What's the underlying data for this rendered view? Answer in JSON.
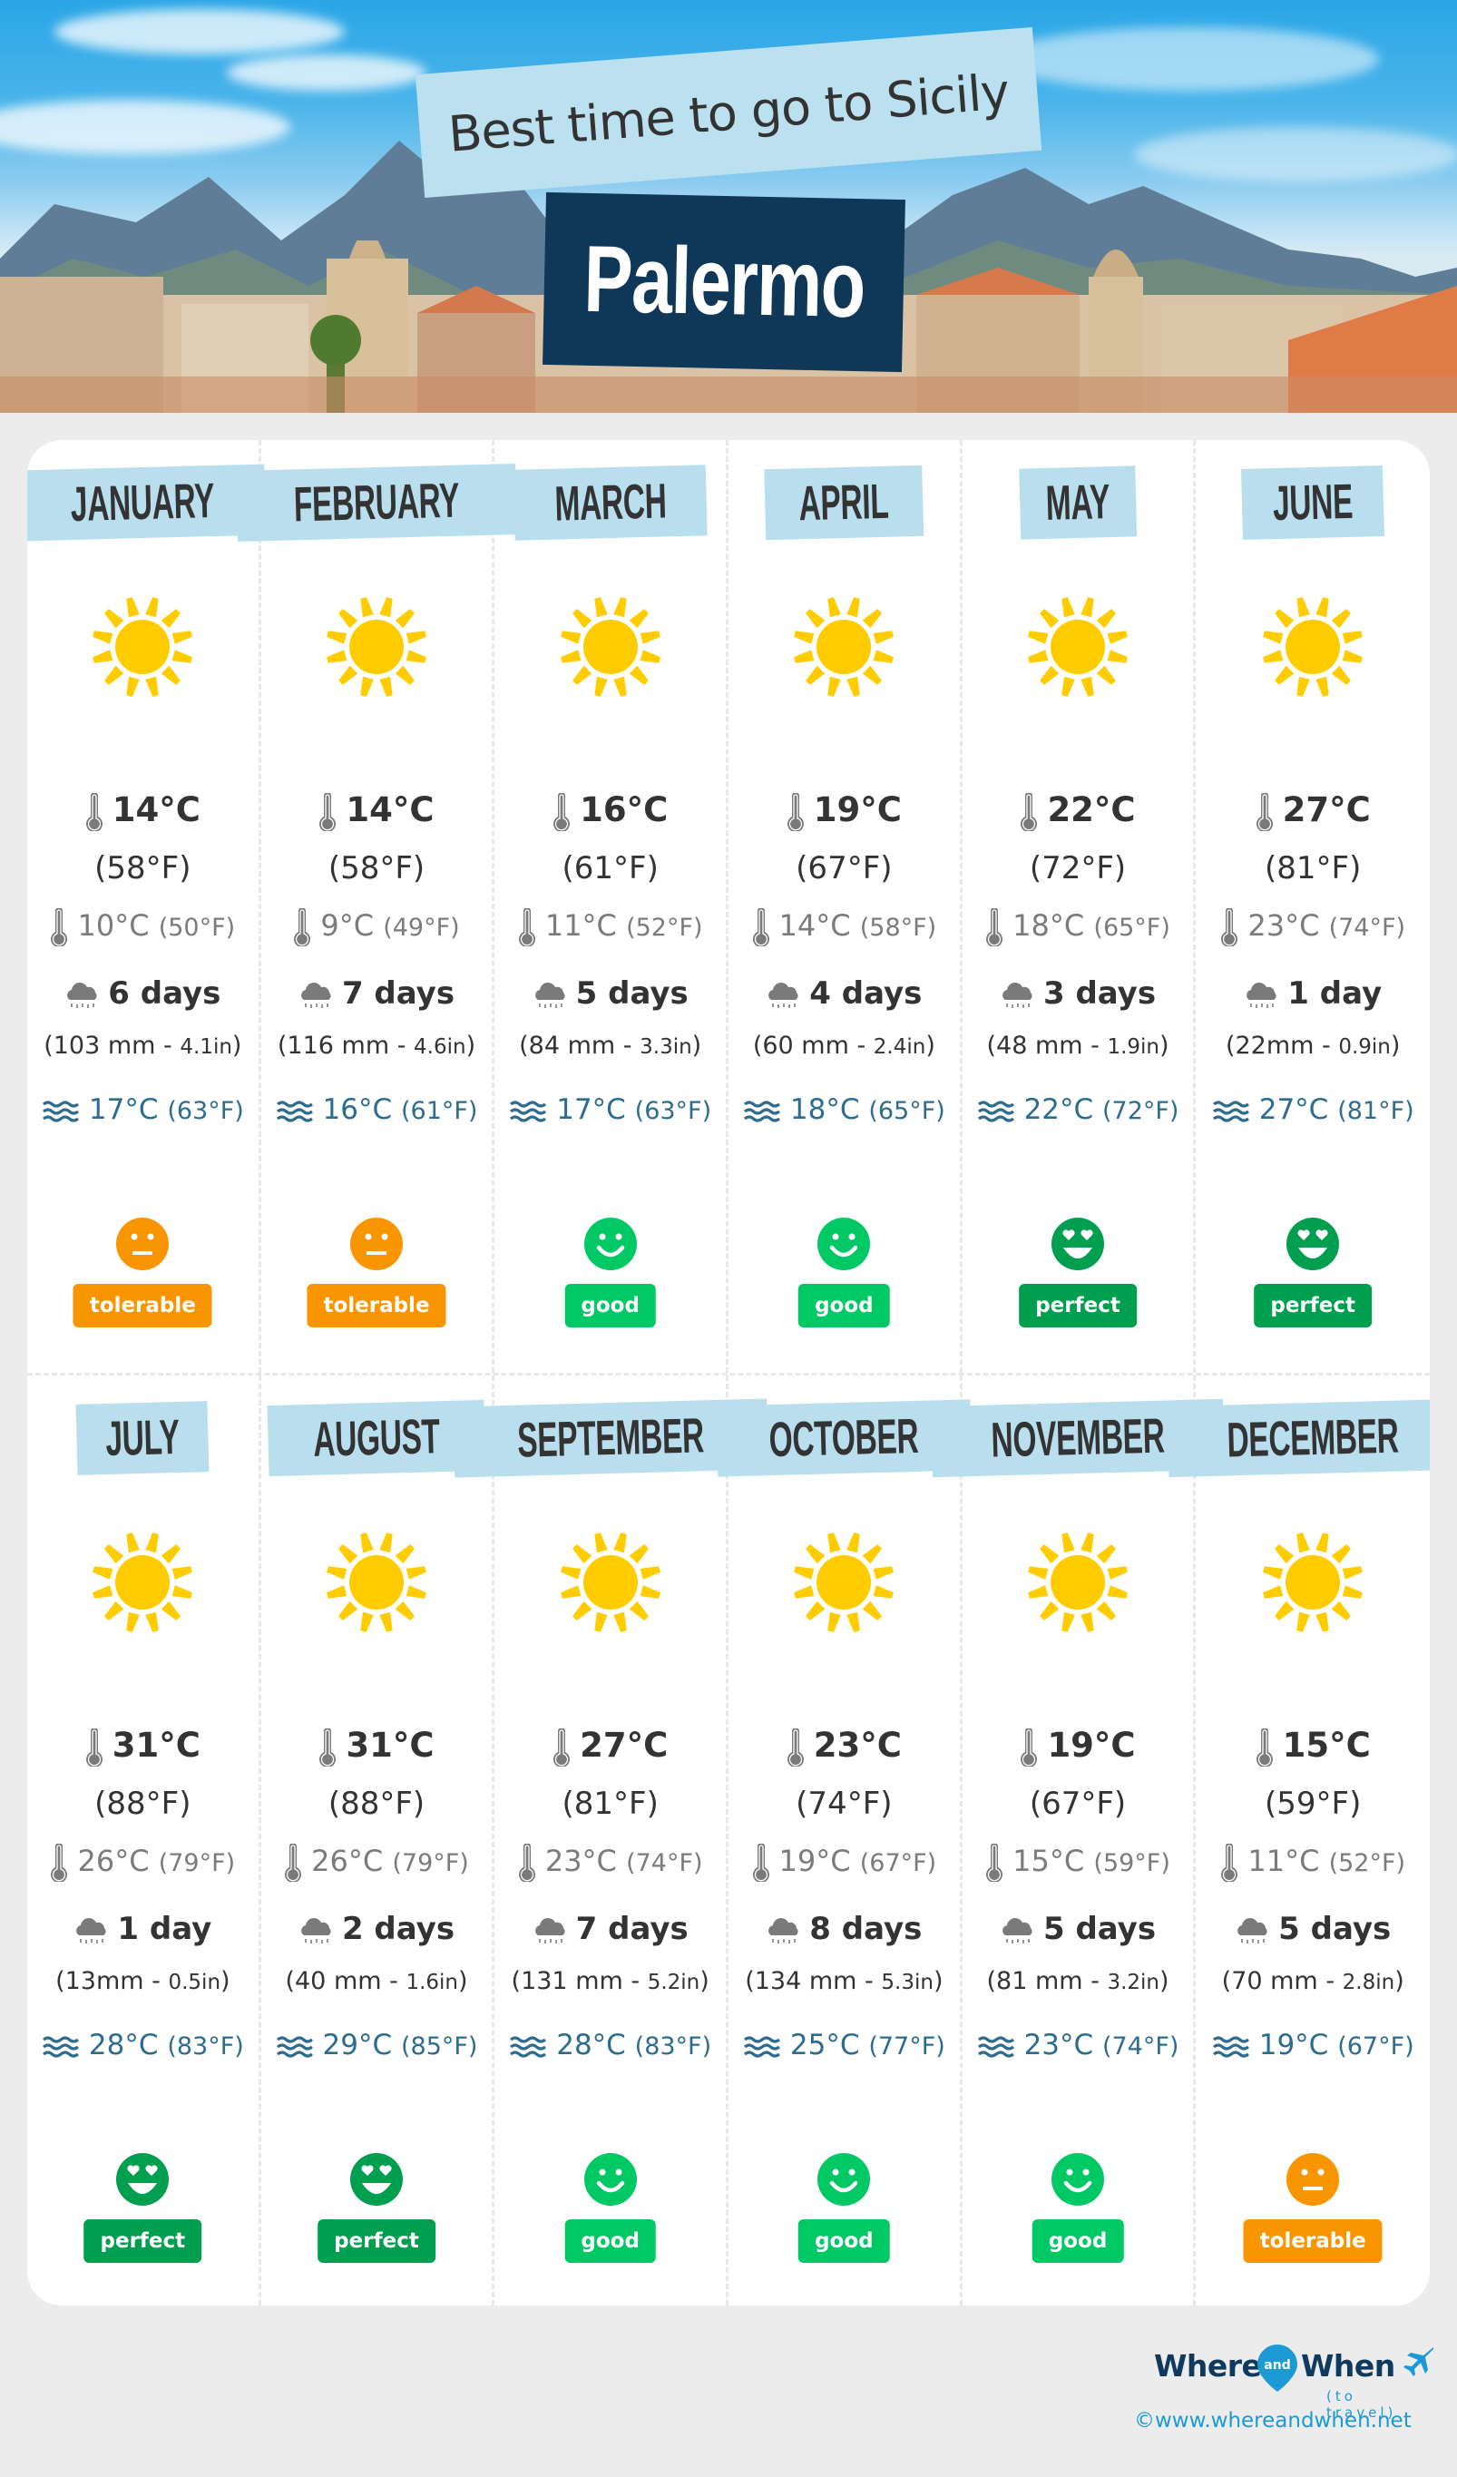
{
  "header": {
    "subtitle": "Best time to go to Sicily",
    "city": "Palermo"
  },
  "colors": {
    "tolerable": "#f99500",
    "good": "#00c865",
    "perfect": "#009e4f",
    "month_tag": "#b9dfef",
    "city_tag": "#0f3757",
    "sea_text": "#2c6d8f",
    "sun": "#ffcc00"
  },
  "months": [
    {
      "name": "JANUARY",
      "weather_icon": "sun-icon",
      "high_c": "14°C",
      "high_f": "(58°F)",
      "low_c": "10°C",
      "low_f": "(50°F)",
      "rain_days": "6 days",
      "rain_mm": "(103 mm - ",
      "rain_in": "4.1in",
      "rain_close": ")",
      "sea_c": "17°C",
      "sea_f": "(63°F)",
      "rating": "tolerable",
      "rating_icon": "neutral-face-icon"
    },
    {
      "name": "FEBRUARY",
      "weather_icon": "sun-icon",
      "high_c": "14°C",
      "high_f": "(58°F)",
      "low_c": "9°C",
      "low_f": "(49°F)",
      "rain_days": "7 days",
      "rain_mm": "(116 mm - ",
      "rain_in": "4.6in",
      "rain_close": ")",
      "sea_c": "16°C",
      "sea_f": "(61°F)",
      "rating": "tolerable",
      "rating_icon": "neutral-face-icon"
    },
    {
      "name": "MARCH",
      "weather_icon": "sun-icon",
      "high_c": "16°C",
      "high_f": "(61°F)",
      "low_c": "11°C",
      "low_f": "(52°F)",
      "rain_days": "5 days",
      "rain_mm": "(84 mm - ",
      "rain_in": "3.3in",
      "rain_close": ")",
      "sea_c": "17°C",
      "sea_f": "(63°F)",
      "rating": "good",
      "rating_icon": "smile-face-icon"
    },
    {
      "name": "APRIL",
      "weather_icon": "sun-icon",
      "high_c": "19°C",
      "high_f": "(67°F)",
      "low_c": "14°C",
      "low_f": "(58°F)",
      "rain_days": "4 days",
      "rain_mm": "(60 mm - ",
      "rain_in": "2.4in",
      "rain_close": ")",
      "sea_c": "18°C",
      "sea_f": "(65°F)",
      "rating": "good",
      "rating_icon": "smile-face-icon"
    },
    {
      "name": "MAY",
      "weather_icon": "sun-icon",
      "high_c": "22°C",
      "high_f": "(72°F)",
      "low_c": "18°C",
      "low_f": "(65°F)",
      "rain_days": "3 days",
      "rain_mm": "(48 mm - ",
      "rain_in": "1.9in",
      "rain_close": ")",
      "sea_c": "22°C",
      "sea_f": "(72°F)",
      "rating": "perfect",
      "rating_icon": "heart-eyes-face-icon"
    },
    {
      "name": "JUNE",
      "weather_icon": "sun-icon",
      "high_c": "27°C",
      "high_f": "(81°F)",
      "low_c": "23°C",
      "low_f": "(74°F)",
      "rain_days": "1 day",
      "rain_mm": "(22mm - ",
      "rain_in": "0.9in",
      "rain_close": ")",
      "sea_c": "27°C",
      "sea_f": "(81°F)",
      "rating": "perfect",
      "rating_icon": "heart-eyes-face-icon"
    },
    {
      "name": "JULY",
      "weather_icon": "sun-icon",
      "high_c": "31°C",
      "high_f": "(88°F)",
      "low_c": "26°C",
      "low_f": "(79°F)",
      "rain_days": "1 day",
      "rain_mm": "(13mm - ",
      "rain_in": "0.5in",
      "rain_close": ")",
      "sea_c": "28°C",
      "sea_f": "(83°F)",
      "rating": "perfect",
      "rating_icon": "heart-eyes-face-icon"
    },
    {
      "name": "AUGUST",
      "weather_icon": "sun-icon",
      "high_c": "31°C",
      "high_f": "(88°F)",
      "low_c": "26°C",
      "low_f": "(79°F)",
      "rain_days": "2 days",
      "rain_mm": "(40 mm - ",
      "rain_in": "1.6in",
      "rain_close": ")",
      "sea_c": "29°C",
      "sea_f": "(85°F)",
      "rating": "perfect",
      "rating_icon": "heart-eyes-face-icon"
    },
    {
      "name": "SEPTEMBER",
      "weather_icon": "sun-icon",
      "high_c": "27°C",
      "high_f": "(81°F)",
      "low_c": "23°C",
      "low_f": "(74°F)",
      "rain_days": "7 days",
      "rain_mm": "(131 mm - ",
      "rain_in": "5.2in",
      "rain_close": ")",
      "sea_c": "28°C",
      "sea_f": "(83°F)",
      "rating": "good",
      "rating_icon": "smile-face-icon"
    },
    {
      "name": "OCTOBER",
      "weather_icon": "sun-icon",
      "high_c": "23°C",
      "high_f": "(74°F)",
      "low_c": "19°C",
      "low_f": "(67°F)",
      "rain_days": "8 days",
      "rain_mm": "(134 mm - ",
      "rain_in": "5.3in",
      "rain_close": ")",
      "sea_c": "25°C",
      "sea_f": "(77°F)",
      "rating": "good",
      "rating_icon": "smile-face-icon"
    },
    {
      "name": "NOVEMBER",
      "weather_icon": "sun-icon",
      "high_c": "19°C",
      "high_f": "(67°F)",
      "low_c": "15°C",
      "low_f": "(59°F)",
      "rain_days": "5 days",
      "rain_mm": "(81 mm - ",
      "rain_in": "3.2in",
      "rain_close": ")",
      "sea_c": "23°C",
      "sea_f": "(74°F)",
      "rating": "good",
      "rating_icon": "smile-face-icon"
    },
    {
      "name": "DECEMBER",
      "weather_icon": "sun-icon",
      "high_c": "15°C",
      "high_f": "(59°F)",
      "low_c": "11°C",
      "low_f": "(52°F)",
      "rain_days": "5 days",
      "rain_mm": "(70 mm - ",
      "rain_in": "2.8in",
      "rain_close": ")",
      "sea_c": "19°C",
      "sea_f": "(67°F)",
      "rating": "tolerable",
      "rating_icon": "neutral-face-icon"
    }
  ],
  "footer": {
    "logo_where": "Where",
    "logo_and": "and",
    "logo_when": "When",
    "logo_sub": "(to travel)",
    "copyright": "©www.whereandwhen.net"
  }
}
